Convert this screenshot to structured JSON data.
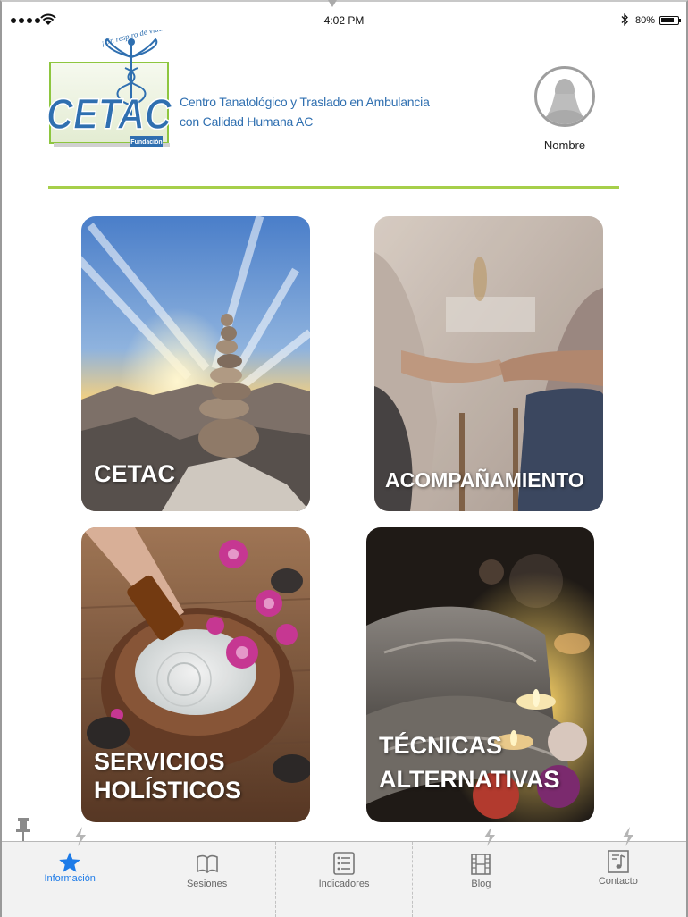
{
  "status_bar": {
    "time": "4:02 PM",
    "battery_percent": "80%",
    "battery_level": 0.8,
    "icons": [
      "cellular-signal-icon",
      "wifi-icon",
      "bluetooth-icon",
      "battery-icon"
    ]
  },
  "header": {
    "logo": {
      "slogan": "¡Un respiro de vida!",
      "wordmark": "CETAC",
      "tag": "Fundación"
    },
    "org_name_line1": "Centro Tanatológico y Traslado en Ambulancia",
    "org_name_line2": "con Calidad Humana AC",
    "profile_name": "Nombre"
  },
  "colors": {
    "divider": "#a6cf4a",
    "brand_blue": "#2f6fb0",
    "tab_active": "#1d7be8",
    "tab_inactive": "#666666"
  },
  "tiles": [
    {
      "label": "CETAC",
      "image": "stacked-stones-sunrise"
    },
    {
      "label": "ACOMPAÑAMIENTO",
      "image": "holding-hands"
    },
    {
      "label_line1": "SERVICIOS",
      "label_line2": "HOLÍSTICOS",
      "image": "aromatherapy-bowl-flowers"
    },
    {
      "label_line1": "TÉCNICAS",
      "label_line2": "ALTERNATIVAS",
      "image": "spa-towels-candles"
    }
  ],
  "tabs": [
    {
      "label": "Información",
      "icon": "star-icon",
      "active": true
    },
    {
      "label": "Sesiones",
      "icon": "book-icon",
      "active": false
    },
    {
      "label": "Indicadores",
      "icon": "list-icon",
      "active": false
    },
    {
      "label": "Blog",
      "icon": "film-icon",
      "active": false
    },
    {
      "label": "Contacto",
      "icon": "music-note-icon",
      "active": false
    }
  ]
}
